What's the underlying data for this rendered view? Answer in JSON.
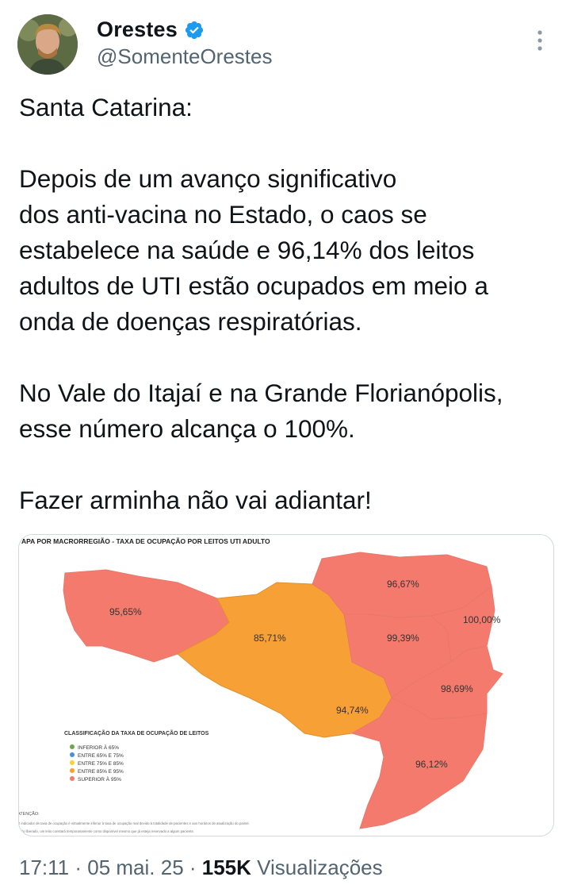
{
  "author": {
    "name": "Orestes",
    "handle": "@SomenteOrestes",
    "verified_icon": "verified-badge-icon",
    "more_icon": "more-options-icon",
    "colors": {
      "verified": "#1d9bf0"
    }
  },
  "tweet": {
    "text": "Santa Catarina:\n\nDepois de um avanço significativo\ndos anti-vacina no Estado, o caos se\nestabelece na saúde e 96,14% dos leitos\nadultos de UTI estão ocupados em meio a\nonda de doenças respiratórias.\n\nNo Vale do Itajaí e na Grande Florianópolis,\nesse número alcança o 100%.\n\nFazer arminha não vai adiantar!"
  },
  "map": {
    "title": "APA POR MACRORREGIÃO - TAXA DE OCUPAÇÃO POR LEITOS UTI ADULTO",
    "regions": [
      {
        "label": "95,65%",
        "value": 95.65,
        "color": "#f47a6e"
      },
      {
        "label": "85,71%",
        "value": 85.71,
        "color": "#f7a036"
      },
      {
        "label": "96,67%",
        "value": 96.67,
        "color": "#f47a6e"
      },
      {
        "label": "99,39%",
        "value": 99.39,
        "color": "#f47a6e"
      },
      {
        "label": "100,00%",
        "value": 100.0,
        "color": "#f47a6e"
      },
      {
        "label": "98,69%",
        "value": 98.69,
        "color": "#f47a6e"
      },
      {
        "label": "94,74%",
        "value": 94.74,
        "color": "#f7a036"
      },
      {
        "label": "96,12%",
        "value": 96.12,
        "color": "#f47a6e"
      }
    ],
    "legend": {
      "title": "CLASSIFICAÇÃO DA TAXA DE OCUPAÇÃO DE LEITOS",
      "items": [
        {
          "label": "INFERIOR À 65%",
          "color": "#6aa84f"
        },
        {
          "label": "ENTRE 65% E 75%",
          "color": "#4a90d9"
        },
        {
          "label": "ENTRE 75% E 85%",
          "color": "#f2d43b"
        },
        {
          "label": "ENTRE 85% E 95%",
          "color": "#f7a036"
        },
        {
          "label": "SUPERIOR À 95%",
          "color": "#f47a6e"
        }
      ]
    },
    "note_title": "ATENÇÃO:",
    "note_lines": [
      "O indicador de taxa de ocupação é virtualmente inferior à taxa de ocupação real devido à totalidade de pacientes e aos horários de atualização do painel.",
      "Leito liberado, um leito constará temporariamente como disponível mesmo que já esteja reservado a algum paciente."
    ]
  },
  "footer": {
    "time": "17:11",
    "sep1": " · ",
    "date": "05 mai. 25",
    "sep2": " · ",
    "views_count": "155K",
    "views_label": " Visualizações"
  }
}
